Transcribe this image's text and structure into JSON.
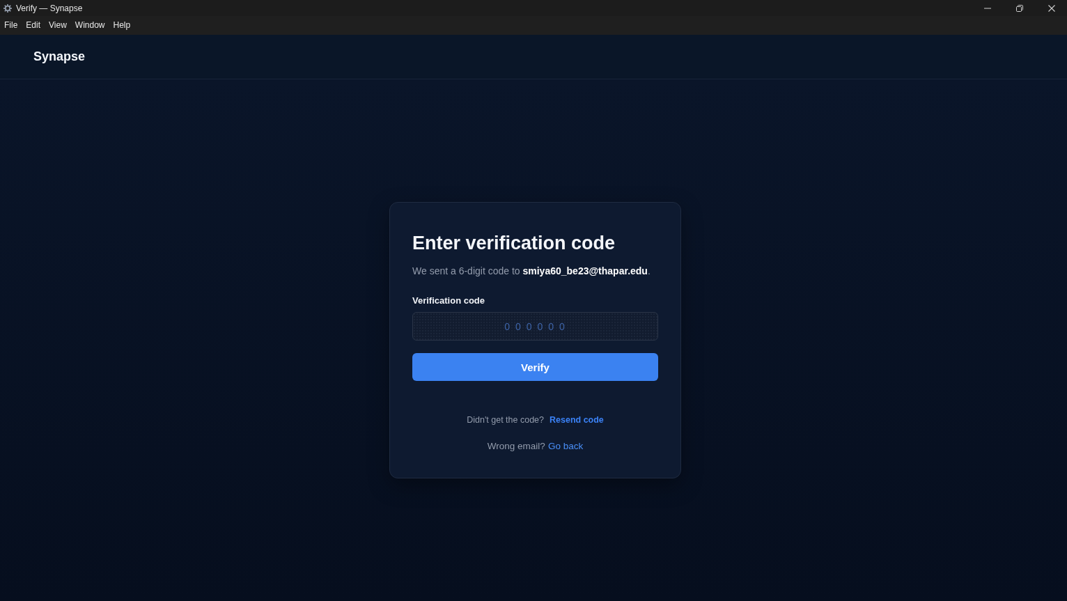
{
  "window": {
    "title": "Verify — Synapse"
  },
  "menu_bar": {
    "items": [
      "File",
      "Edit",
      "View",
      "Window",
      "Help"
    ]
  },
  "header": {
    "brand": "Synapse"
  },
  "card": {
    "heading": "Enter verification code",
    "subtitle": "We sent a 6-digit code to **smiya60_be23@thapar.edu**.",
    "field": {
      "label": "Verification code",
      "placeholder": "000000"
    },
    "button": "Verify",
    "links": [
      {
        "prompt": "Didn't get the code?",
        "link": "Resend code"
      },
      {
        "prompt": "Wrong email?",
        "link": "Go back"
      }
    ]
  }
}
